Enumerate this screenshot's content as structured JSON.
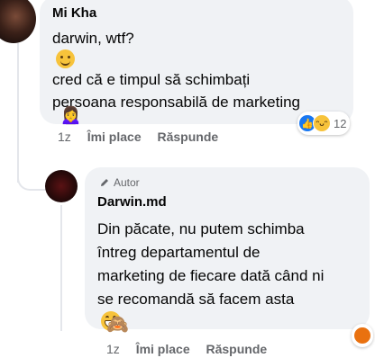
{
  "comment": {
    "author": "Mi Kha",
    "lines": [
      "darwin, wtf?",
      "cred că e timpul să schimbați",
      "persoana responsabilă de marketing"
    ],
    "sticker": "🙍‍♀️",
    "timestamp": "1z",
    "like_label": "Îmi place",
    "reply_label": "Răspunde",
    "reaction_count": "12"
  },
  "reply": {
    "badge": "Autor",
    "author": "Darwin.md",
    "lines": [
      "Din păcate, nu putem schimba",
      "întreg departamentul de",
      "marketing de fiecare dată când ni",
      "se recomandă să facem asta"
    ],
    "sticker": "🙈",
    "timestamp": "1z",
    "like_label": "Îmi place",
    "reply_label": "Răspunde"
  },
  "colors": {
    "bubble": "#f0f2f5",
    "meta": "#65676b",
    "like_blue": "#1877f2"
  }
}
